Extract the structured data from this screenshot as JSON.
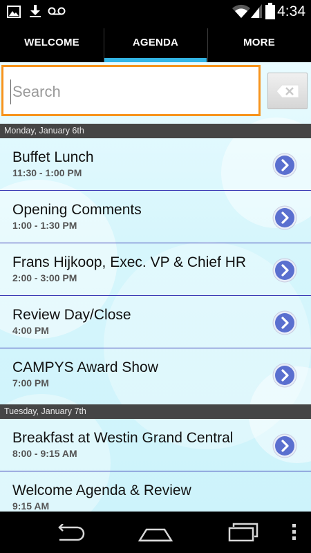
{
  "status_bar": {
    "time": "4:34",
    "icons": [
      "image-icon",
      "download-icon",
      "voicemail-icon",
      "wifi-icon",
      "cell-signal-icon",
      "battery-icon"
    ]
  },
  "tabs": [
    {
      "label": "WELCOME",
      "active": false
    },
    {
      "label": "AGENDA",
      "active": true
    },
    {
      "label": "MORE",
      "active": false
    }
  ],
  "search": {
    "placeholder": "Search",
    "value": ""
  },
  "colors": {
    "accent": "#33b5e5",
    "search_border": "#f7941d",
    "divider": "#3b3bb5",
    "header_bg": "#454545"
  },
  "agenda": {
    "monday": {
      "header": "Monday, January 6th",
      "items": [
        {
          "title": "Buffet Lunch",
          "time": "11:30 - 1:00 PM"
        },
        {
          "title": "Opening Comments",
          "time": "1:00 - 1:30 PM"
        },
        {
          "title": "Frans Hijkoop, Exec. VP & Chief HR",
          "time": "2:00 - 3:00 PM"
        },
        {
          "title": "Review Day/Close",
          "time": "4:00 PM"
        },
        {
          "title": "CAMPYS Award Show",
          "time": "7:00 PM"
        }
      ]
    },
    "tuesday": {
      "header": "Tuesday, January 7th",
      "items": [
        {
          "title": "Breakfast at Westin Grand Central",
          "time": "8:00 - 9:15 AM"
        },
        {
          "title": "Welcome Agenda & Review",
          "time": "9:15 AM"
        }
      ]
    }
  },
  "navbar": {
    "icons": [
      "back-icon",
      "home-icon",
      "recent-apps-icon",
      "overflow-menu-icon"
    ]
  }
}
